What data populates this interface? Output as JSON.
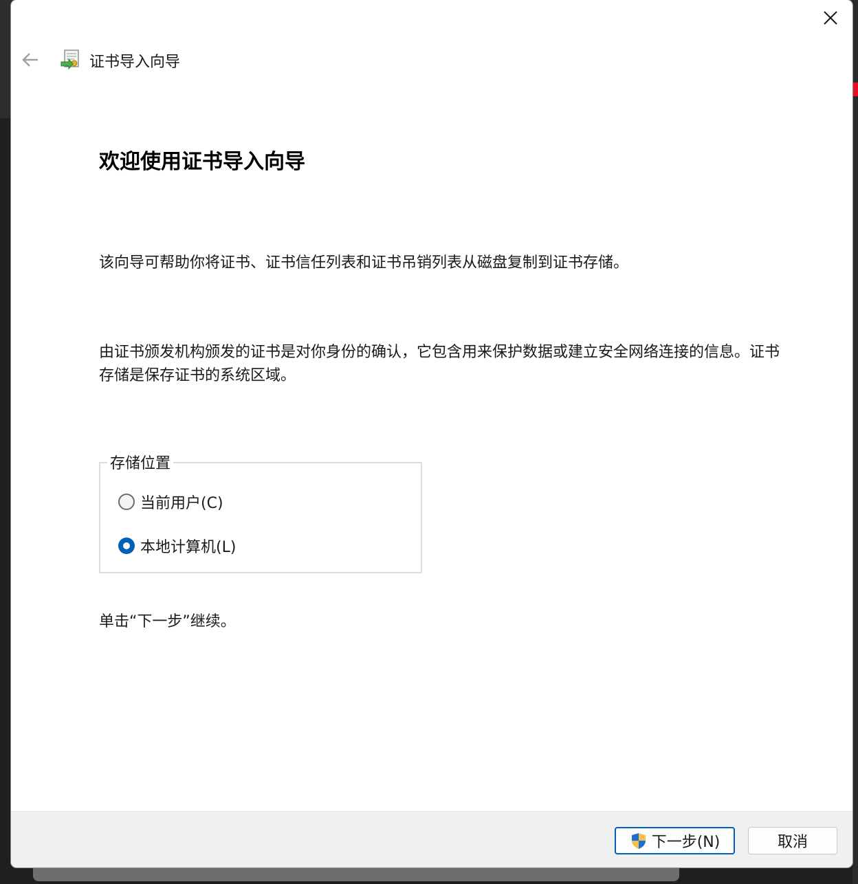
{
  "window": {
    "title": "证书导入向导"
  },
  "content": {
    "heading": "欢迎使用证书导入向导",
    "paragraph1": "该向导可帮助你将证书、证书信任列表和证书吊销列表从磁盘复制到证书存储。",
    "paragraph2": "由证书颁发机构颁发的证书是对你身份的确认，它包含用来保护数据或建立安全网络连接的信息。证书存储是保存证书的系统区域。",
    "store_location": {
      "legend": "存储位置",
      "options": [
        {
          "label": "当前用户(C)",
          "selected": false
        },
        {
          "label": "本地计算机(L)",
          "selected": true
        }
      ]
    },
    "hint": "单击“下一步”继续。"
  },
  "footer": {
    "next_label": "下一步(N)",
    "cancel_label": "取消"
  },
  "colors": {
    "accent": "#005fb8",
    "footer_bg": "#f0f0f0"
  },
  "icons": [
    "back-arrow-icon",
    "certificate-icon",
    "close-icon",
    "uac-shield-icon"
  ]
}
